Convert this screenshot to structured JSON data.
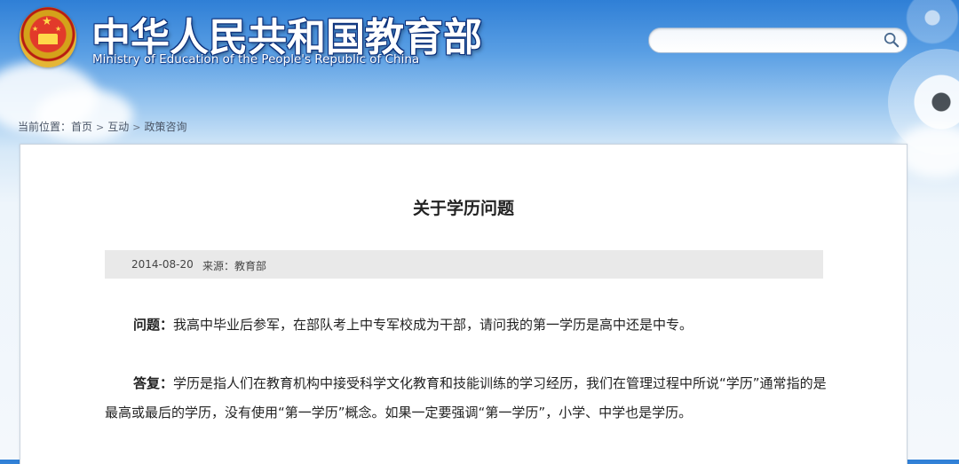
{
  "header": {
    "title": "中华人民共和国教育部",
    "subtitle": "Ministry of Education of the People's Republic of China",
    "emblem_icon": "national-emblem-icon"
  },
  "search": {
    "placeholder": "",
    "value": "",
    "icon": "search-icon"
  },
  "breadcrumb": {
    "prefix": "当前位置：",
    "items": [
      "首页",
      "互动",
      "政策咨询"
    ],
    "separator": ">"
  },
  "article": {
    "title": "关于学历问题",
    "date": "2014-08-20",
    "source": "来源：教育部",
    "question_label": "问题：",
    "question_text": "我高中毕业后参军，在部队考上中专军校成为干部，请问我的第一学历是高中还是中专。",
    "answer_label": "答复：",
    "answer_text": "学历是指人们在教育机构中接受科学文化教育和技能训练的学习经历，我们在管理过程中所说“学历”通常指的是最高或最后的学历，没有使用“第一学历”概念。如果一定要强调“第一学历”，小学、中学也是学历。"
  },
  "colors": {
    "header_blue": "#2f7fd6",
    "title_outline": "#0b2f7a",
    "meta_bar": "#e9e9e9"
  }
}
